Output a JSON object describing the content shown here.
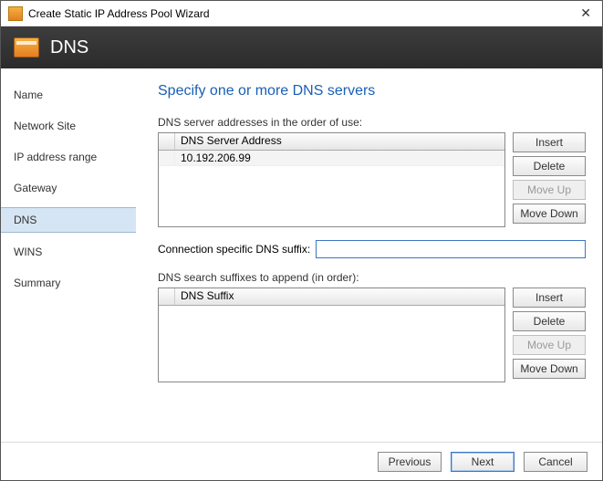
{
  "window": {
    "title": "Create Static IP Address Pool Wizard"
  },
  "banner": {
    "title": "DNS"
  },
  "sidebar": {
    "items": [
      {
        "label": "Name"
      },
      {
        "label": "Network Site"
      },
      {
        "label": "IP address range"
      },
      {
        "label": "Gateway"
      },
      {
        "label": "DNS"
      },
      {
        "label": "WINS"
      },
      {
        "label": "Summary"
      }
    ],
    "selected_index": 4
  },
  "main": {
    "heading": "Specify one or more DNS servers",
    "dns_servers": {
      "label": "DNS server addresses in the order of use:",
      "column_header": "DNS Server Address",
      "rows": [
        {
          "value": "10.192.206.99"
        }
      ],
      "buttons": {
        "insert": "Insert",
        "delete": "Delete",
        "move_up": "Move Up",
        "move_down": "Move Down"
      }
    },
    "dns_suffix": {
      "label": "Connection specific DNS suffix:",
      "value": ""
    },
    "search_suffixes": {
      "label": "DNS search suffixes to append (in order):",
      "column_header": "DNS Suffix",
      "rows": [],
      "buttons": {
        "insert": "Insert",
        "delete": "Delete",
        "move_up": "Move Up",
        "move_down": "Move Down"
      }
    }
  },
  "footer": {
    "previous": "Previous",
    "next": "Next",
    "cancel": "Cancel"
  }
}
